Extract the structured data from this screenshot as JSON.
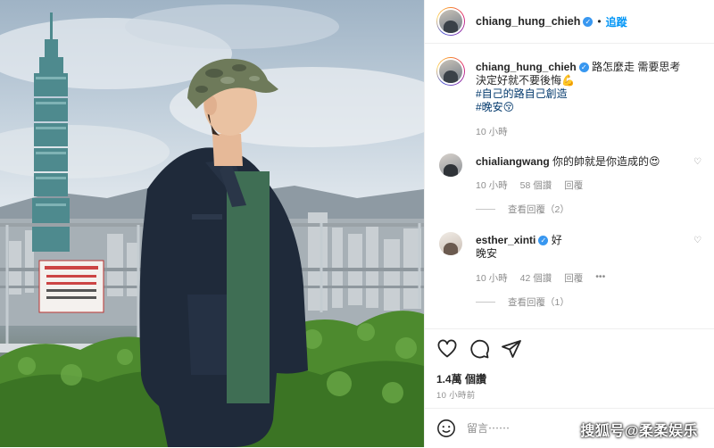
{
  "header": {
    "username": "chiang_hung_chieh",
    "follow": "追蹤"
  },
  "post": {
    "author": "chiang_hung_chieh",
    "caption_line1": "路怎麼走 需要思考",
    "caption_line2": "決定好就不要後悔💪",
    "caption_line3": "#自己的路自己創造",
    "caption_line4": "#晚安😚",
    "time": "10 小時"
  },
  "comments": [
    {
      "user": "chialiangwang",
      "text": "你的帥就是你造成的😍",
      "time": "10 小時",
      "likes": "58 個讚",
      "reply": "回覆",
      "view_replies": "查看回覆（2）"
    },
    {
      "user": "esther_xinti",
      "text": "好",
      "text2": "晚安",
      "time": "10 小時",
      "likes": "42 個讚",
      "reply": "回覆",
      "view_replies": "查看回覆（1）"
    }
  ],
  "actions": {
    "likes": "1.4萬 個讚",
    "time": "10 小時前"
  },
  "add_comment": {
    "placeholder": "留言⋯⋯"
  },
  "sign_text": "中華民國臺北市 觀景台 CAUTION PLEASE DO NOT LEAN",
  "watermark": "搜狐号@柔柔娱乐"
}
